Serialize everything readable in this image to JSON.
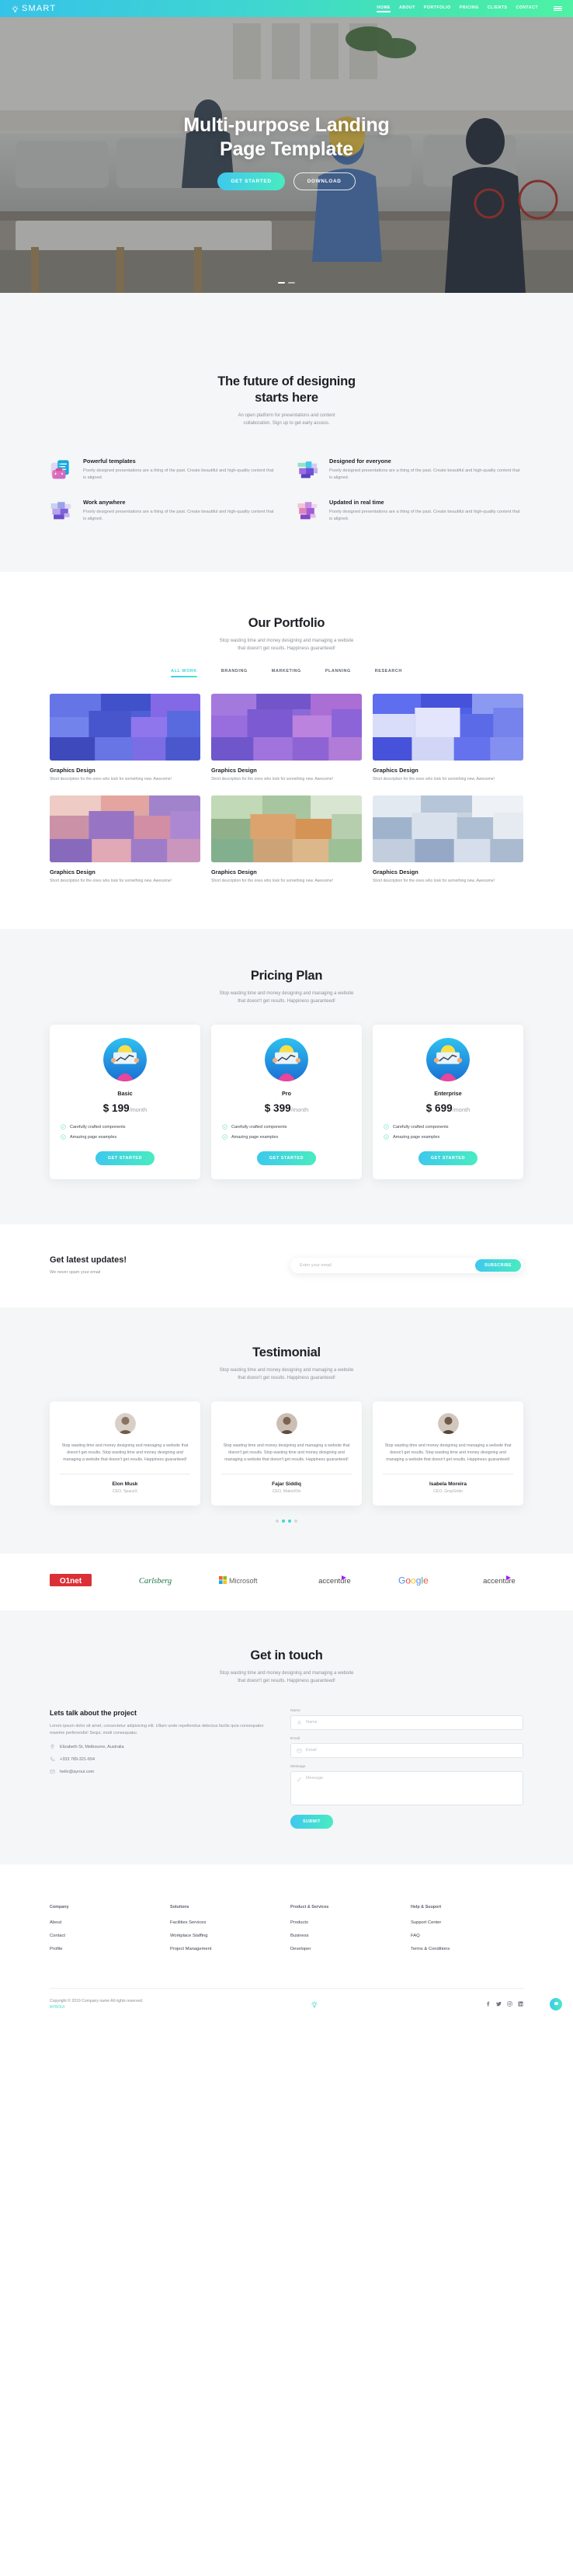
{
  "header": {
    "brand": "SMART",
    "logo_icon": "lightbulb-icon",
    "nav": [
      {
        "label": "HOME",
        "active": true
      },
      {
        "label": "ABOUT",
        "active": false
      },
      {
        "label": "PORTFOLIO",
        "active": false
      },
      {
        "label": "PRICING",
        "active": false
      },
      {
        "label": "CLIENTS",
        "active": false
      },
      {
        "label": "CONTACT",
        "active": false
      }
    ],
    "menu_icon": "hamburger-menu-icon"
  },
  "hero": {
    "title_line1": "Multi-purpose Landing",
    "title_line2": "Page Template",
    "primary_button": "GET STARTED",
    "secondary_button": "DOWNLOAD",
    "slider_dots": 2,
    "active_dot": 0
  },
  "future": {
    "title_line1": "The future of designing",
    "title_line2": "starts here",
    "subtitle_line1": "An open platform for presentations and content",
    "subtitle_line2": "collaboration. Sign up to get early access.",
    "features": [
      {
        "icon": "templates-icon",
        "title": "Powerful templates",
        "body": "Poorly designed presentations are a thing of the past. Create beautiful and high-quality content that is aligned."
      },
      {
        "icon": "people-icon",
        "title": "Designed for everyone",
        "body": "Poorly designed presentations are a thing of the past. Create beautiful and high-quality content that is aligned."
      },
      {
        "icon": "laptop-icon",
        "title": "Work anywhere",
        "body": "Poorly designed presentations are a thing of the past. Create beautiful and high-quality content that is aligned."
      },
      {
        "icon": "realtime-icon",
        "title": "Updated in real time",
        "body": "Poorly designed presentations are a thing of the past. Create beautiful and high-quality content that is aligned."
      }
    ]
  },
  "portfolio": {
    "title": "Our Portfolio",
    "subtitle_line1": "Stop wasting time and money designing and managing a website",
    "subtitle_line2": "that doesn't get results. Happiness guaranteed!",
    "tabs": [
      {
        "label": "ALL WORK",
        "active": true
      },
      {
        "label": "BRANDING",
        "active": false
      },
      {
        "label": "MARKETING",
        "active": false
      },
      {
        "label": "PLANNING",
        "active": false
      },
      {
        "label": "RESEARCH",
        "active": false
      }
    ],
    "items": [
      {
        "title": "Graphics Design",
        "desc": "Short description for the ones who look for something new. Awesome!",
        "c1": "#5b6fe0",
        "c2": "#8c6be8",
        "c3": "#3d4fc7"
      },
      {
        "title": "Graphics Design",
        "desc": "Short description for the ones who look for something new. Awesome!",
        "c1": "#8b6ad8",
        "c2": "#b16fd4",
        "c3": "#6a53c9"
      },
      {
        "title": "Graphics Design",
        "desc": "Short description for the ones who look for something new. Awesome!",
        "c1": "#5d6de8",
        "c2": "#93a0f2",
        "c3": "#4452d8"
      },
      {
        "title": "Graphics Design",
        "desc": "Short description for the ones who look for something new. Awesome!",
        "c1": "#e5a5a0",
        "c2": "#9b7fd0",
        "c3": "#d18ba6"
      },
      {
        "title": "Graphics Design",
        "desc": "Short description for the ones who look for something new. Awesome!",
        "c1": "#a8c6a0",
        "c2": "#e2a06a",
        "c3": "#7fae8c"
      },
      {
        "title": "Graphics Design",
        "desc": "Short description for the ones who look for something new. Awesome!",
        "c1": "#c9d3e0",
        "c2": "#9fb2cc",
        "c3": "#e4eaf1"
      }
    ]
  },
  "pricing": {
    "title": "Pricing Plan",
    "subtitle_line1": "Stop wasting time and money designing and managing a website",
    "subtitle_line2": "that doesn't get results. Happiness guaranteed!",
    "plans": [
      {
        "name": "Basic",
        "price": "$ 199",
        "period": "/month",
        "features": [
          "Carefully crafted components",
          "Amazing page examples"
        ],
        "button": "GET STARTED"
      },
      {
        "name": "Pro",
        "price": "$ 399",
        "period": "/month",
        "features": [
          "Carefully crafted components",
          "Amazing page examples"
        ],
        "button": "GET STARTED"
      },
      {
        "name": "Enterprise",
        "price": "$ 699",
        "period": "/month",
        "features": [
          "Carefully crafted components",
          "Amazing page examples"
        ],
        "button": "GET STARTED"
      }
    ]
  },
  "newsletter": {
    "title": "Get latest updates!",
    "note": "We never spam your email",
    "placeholder": "Enter your email",
    "value": "",
    "button": "SUBSCRIBE"
  },
  "testimonial": {
    "title": "Testimonial",
    "subtitle_line1": "Stop wasting time and money designing and managing a website",
    "subtitle_line2": "that doesn't get results. Happiness guaranteed!",
    "items": [
      {
        "quote": "Stop wasting time and money designing and managing a website that doesn't get results. Stop wasting time and money designing and managing a website that doesn't get results. Happiness guaranteed!",
        "name": "Elon Musk",
        "role": "CEO, SpaceX"
      },
      {
        "quote": "Stop wasting time and money designing and managing a website that doesn't get results. Stop wasting time and money designing and managing a website that doesn't get results. Happiness guaranteed!",
        "name": "Fajar Siddiq",
        "role": "CEO, MakerFlix"
      },
      {
        "quote": "Stop wasting time and money designing and managing a website that doesn't get results. Stop wasting time and money designing and managing a website that doesn't get results. Happiness guaranteed!",
        "name": "Isabela Moreira",
        "role": "CEO, GrayGrids"
      }
    ],
    "dots": 4,
    "active_dot": 1
  },
  "clients": {
    "logos": [
      "O1net",
      "Carlsberg",
      "Microsoft",
      "accenture",
      "Google",
      "accenture"
    ]
  },
  "contact": {
    "title": "Get in touch",
    "subtitle_line1": "Stop wasting time and money designing and managing a website",
    "subtitle_line2": "that doesn't get results. Happiness guaranteed!",
    "left_title": "Lets talk about the project",
    "left_body": "Lorem ipsum dolor sit amet, consectetur adipisicing elit. Ullam unde repellendus delectus facilis quia consequatur maxime perferendis! Sequi, modi consequatur.",
    "address": "Elizabeth St, Melbourne, Australia",
    "phone": "+333 789-321-654",
    "email": "hello@ayroui.com",
    "form": {
      "name_label": "Name",
      "name_placeholder": "Name",
      "name_value": "",
      "email_label": "Email",
      "email_placeholder": "Email",
      "email_value": "",
      "message_label": "Message",
      "message_placeholder": "Message",
      "message_value": "",
      "submit": "SUBMIT"
    }
  },
  "footer": {
    "columns": [
      {
        "heading": "Company",
        "links": [
          "About",
          "Contact",
          "Profile"
        ]
      },
      {
        "heading": "Solutions",
        "links": [
          "Facilities Services",
          "Workplace Staffing",
          "Project Management"
        ]
      },
      {
        "heading": "Product & Services",
        "links": [
          "Products",
          "Business",
          "Developer"
        ]
      },
      {
        "heading": "Help & Suuport",
        "links": [
          "Support Center",
          "FAQ",
          "Terms & Conditions"
        ]
      }
    ],
    "copyright": "Copyright © 2019 Company name All rights reserved.",
    "credit": "AYROUI",
    "social": [
      "facebook-icon",
      "twitter-icon",
      "instagram-icon",
      "linkedin-icon"
    ],
    "logo_icon": "lightbulb-icon"
  },
  "fab": {
    "icon": "chat-icon"
  },
  "colors": {
    "accent_start": "#3ec8ee",
    "accent_end": "#49ecc0",
    "teal": "#3fd9cf",
    "grey_bg": "#f5f6f7",
    "text_dark": "#1d2025",
    "text_muted": "#8b9098"
  }
}
